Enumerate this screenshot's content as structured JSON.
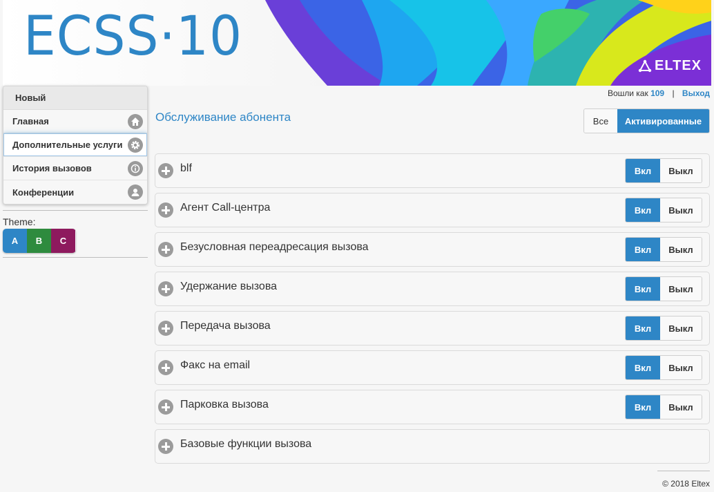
{
  "header": {
    "logo": "ECSS·10",
    "brand": "ELTEX"
  },
  "user": {
    "logged_in_label": "Вошли как",
    "number": "109",
    "separator": "|",
    "logout": "Выход"
  },
  "sidebar": {
    "head": "Новый",
    "items": [
      {
        "label": "Главная",
        "icon": "home-icon"
      },
      {
        "label": "Дополнительные услуги",
        "icon": "gear-icon"
      },
      {
        "label": "История вызовов",
        "icon": "info-icon"
      },
      {
        "label": "Конференции",
        "icon": "user-icon"
      }
    ],
    "active_index": 1,
    "theme_label": "Theme:",
    "themes": [
      {
        "label": "A",
        "color": "#2e86c6"
      },
      {
        "label": "B",
        "color": "#2e8b3e"
      },
      {
        "label": "C",
        "color": "#8e1a5e"
      }
    ]
  },
  "main": {
    "title": "Обслуживание абонента",
    "filter": {
      "all": "Все",
      "activated": "Активированные",
      "selected": "activated"
    },
    "on_label": "Вкл",
    "off_label": "Выкл",
    "services": [
      {
        "name": "blf",
        "toggle": true,
        "state": "on"
      },
      {
        "name": "Агент Call-центра",
        "toggle": true,
        "state": "on"
      },
      {
        "name": "Безусловная переадресация вызова",
        "toggle": true,
        "state": "on"
      },
      {
        "name": "Удержание вызова",
        "toggle": true,
        "state": "on"
      },
      {
        "name": "Передача вызова",
        "toggle": true,
        "state": "on"
      },
      {
        "name": "Факс на email",
        "toggle": true,
        "state": "on"
      },
      {
        "name": "Парковка вызова",
        "toggle": true,
        "state": "on"
      },
      {
        "name": "Базовые функции вызова",
        "toggle": false
      }
    ]
  },
  "footer": {
    "copyright": "© 2018 Eltex"
  },
  "colors": {
    "accent": "#2e86c6"
  }
}
